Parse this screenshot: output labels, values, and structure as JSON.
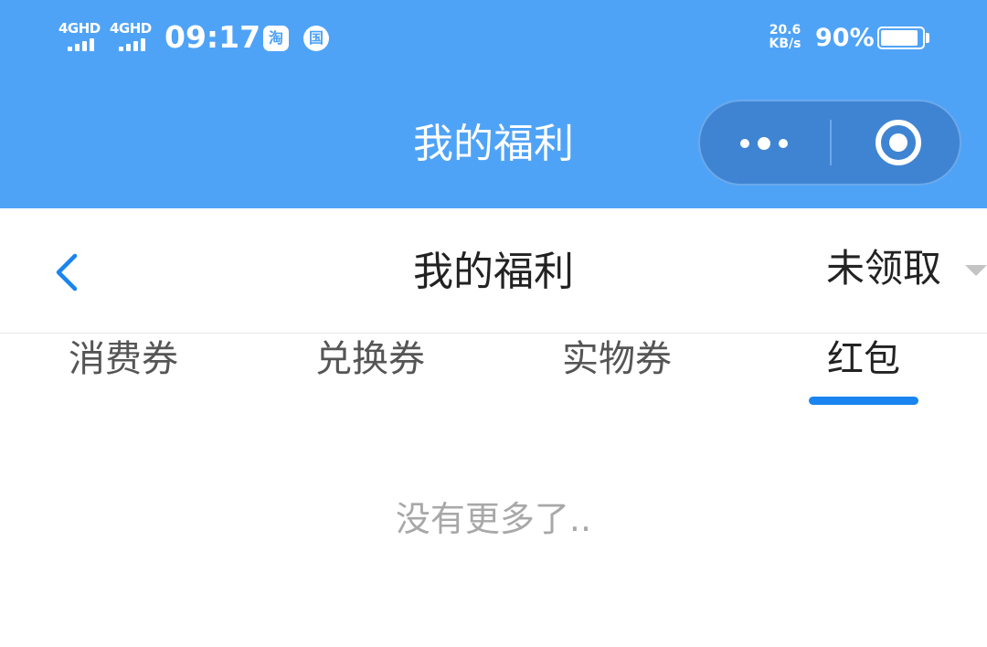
{
  "status_bar": {
    "signal_1": "4GHD",
    "signal_2": "4GHD",
    "time": "09:17",
    "app_icon_1": "淘",
    "app_icon_2": "国",
    "net_speed_value": "20.6",
    "net_speed_unit": "KB/s",
    "battery_percent_label": "90%",
    "battery_level": 0.9
  },
  "mini_program_header": {
    "title": "我的福利",
    "more_icon": "more-dots-icon",
    "close_icon": "target-close-icon"
  },
  "page_nav": {
    "back_icon": "chevron-left-icon",
    "title": "我的福利",
    "filter_label": "未领取",
    "filter_icon": "caret-down-icon"
  },
  "tabs": [
    {
      "label": "消费券",
      "active": false
    },
    {
      "label": "兑换券",
      "active": false
    },
    {
      "label": "实物券",
      "active": false
    },
    {
      "label": "红包",
      "active": true
    }
  ],
  "content": {
    "empty_text": "没有更多了.."
  },
  "colors": {
    "header_blue": "#4fa3f7",
    "capsule_blue": "#3f84d2",
    "accent_blue": "#1a84f0",
    "text_dark": "#222222",
    "text_muted": "#a8a8a8"
  }
}
